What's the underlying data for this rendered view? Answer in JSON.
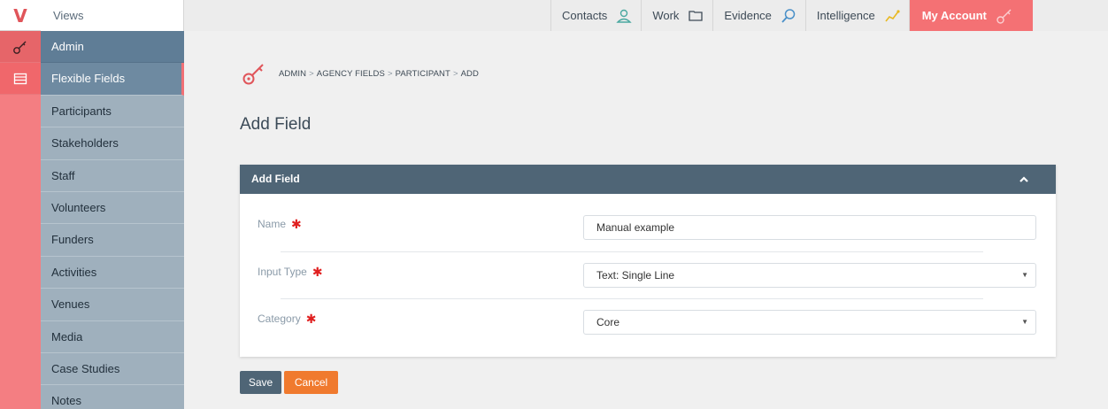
{
  "brand": {
    "logo": "V"
  },
  "topbar": {
    "views_label": "Views",
    "nav": [
      {
        "label": "Contacts",
        "icon": "person-icon"
      },
      {
        "label": "Work",
        "icon": "folder-icon"
      },
      {
        "label": "Evidence",
        "icon": "magnifier-icon"
      },
      {
        "label": "Intelligence",
        "icon": "trend-icon"
      },
      {
        "label": "My Account",
        "icon": "key-icon",
        "active": true
      }
    ]
  },
  "sidebar": {
    "items": [
      {
        "label": "Admin"
      },
      {
        "label": "Flexible Fields"
      },
      {
        "label": "Participants"
      },
      {
        "label": "Stakeholders"
      },
      {
        "label": "Staff"
      },
      {
        "label": "Volunteers"
      },
      {
        "label": "Funders"
      },
      {
        "label": "Activities"
      },
      {
        "label": "Venues"
      },
      {
        "label": "Media"
      },
      {
        "label": "Case Studies"
      },
      {
        "label": "Notes"
      }
    ]
  },
  "breadcrumb": [
    "ADMIN",
    "AGENCY FIELDS",
    "PARTICIPANT",
    "ADD"
  ],
  "page": {
    "title": "Add Field"
  },
  "panel": {
    "title": "Add Field",
    "fields": {
      "name": {
        "label": "Name",
        "value": "Manual example"
      },
      "input_type": {
        "label": "Input Type",
        "value": "Text: Single Line"
      },
      "category": {
        "label": "Category",
        "value": "Core"
      }
    }
  },
  "buttons": {
    "save": "Save",
    "cancel": "Cancel"
  },
  "colors": {
    "accent": "#f47174",
    "header": "#4f6576",
    "cancel": "#f07a2e",
    "required": "#e02020"
  }
}
